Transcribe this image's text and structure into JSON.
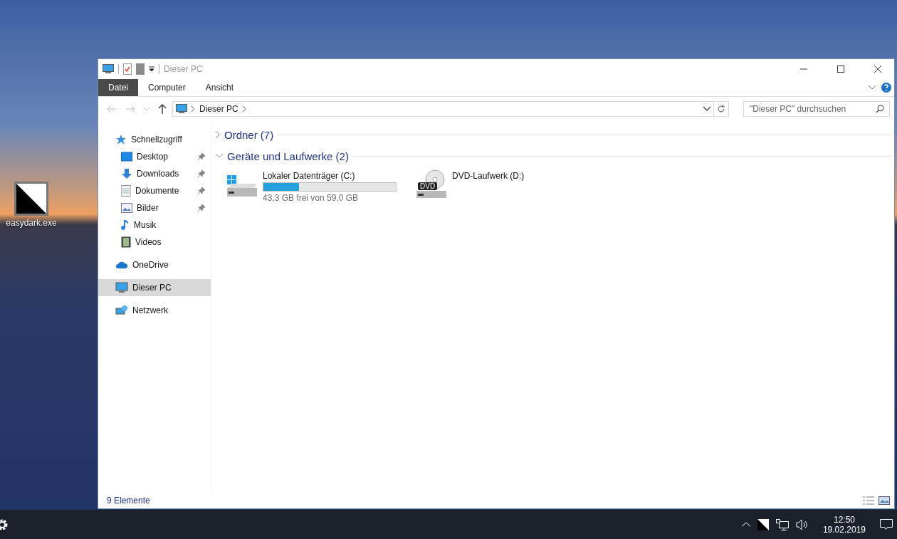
{
  "desktop_icons": [
    {
      "label": "easydark.exe"
    }
  ],
  "window": {
    "title": "Dieser PC"
  },
  "ribbon_tabs": [
    {
      "label": "Datei",
      "selected": true
    },
    {
      "label": "Computer",
      "selected": false
    },
    {
      "label": "Ansicht",
      "selected": false
    }
  ],
  "address": {
    "path": "Dieser PC"
  },
  "search": {
    "placeholder": "\"Dieser PC\" durchsuchen"
  },
  "sidebar": {
    "items": [
      {
        "label": "Schnellzugriff",
        "selected": false,
        "children": [
          {
            "label": "Desktop",
            "pinned": true,
            "selected": false
          },
          {
            "label": "Downloads",
            "pinned": true,
            "selected": false
          },
          {
            "label": "Dokumente",
            "pinned": true,
            "selected": false
          },
          {
            "label": "Bilder",
            "pinned": true,
            "selected": false
          },
          {
            "label": "Musik",
            "pinned": false,
            "selected": false
          },
          {
            "label": "Videos",
            "pinned": false,
            "selected": false
          }
        ]
      },
      {
        "label": "OneDrive",
        "selected": false
      },
      {
        "label": "Dieser PC",
        "selected": true
      },
      {
        "label": "Netzwerk",
        "selected": false
      }
    ]
  },
  "groups": [
    {
      "label": "Ordner (7)",
      "expanded": false
    },
    {
      "label": "Geräte und Laufwerke (2)",
      "expanded": true,
      "drives": [
        {
          "kind": "disk",
          "label": "Lokaler Datenträger (C:)",
          "level": 0.27,
          "detail": "43,3 GB frei von 59,0 GB"
        },
        {
          "kind": "dvd",
          "label": "DVD-Laufwerk (D:)",
          "badge": "DVD"
        }
      ]
    }
  ],
  "status_bar": {
    "count": "9 Elemente"
  },
  "taskbar": {
    "time": "12:50",
    "date": "19.02.2019"
  }
}
